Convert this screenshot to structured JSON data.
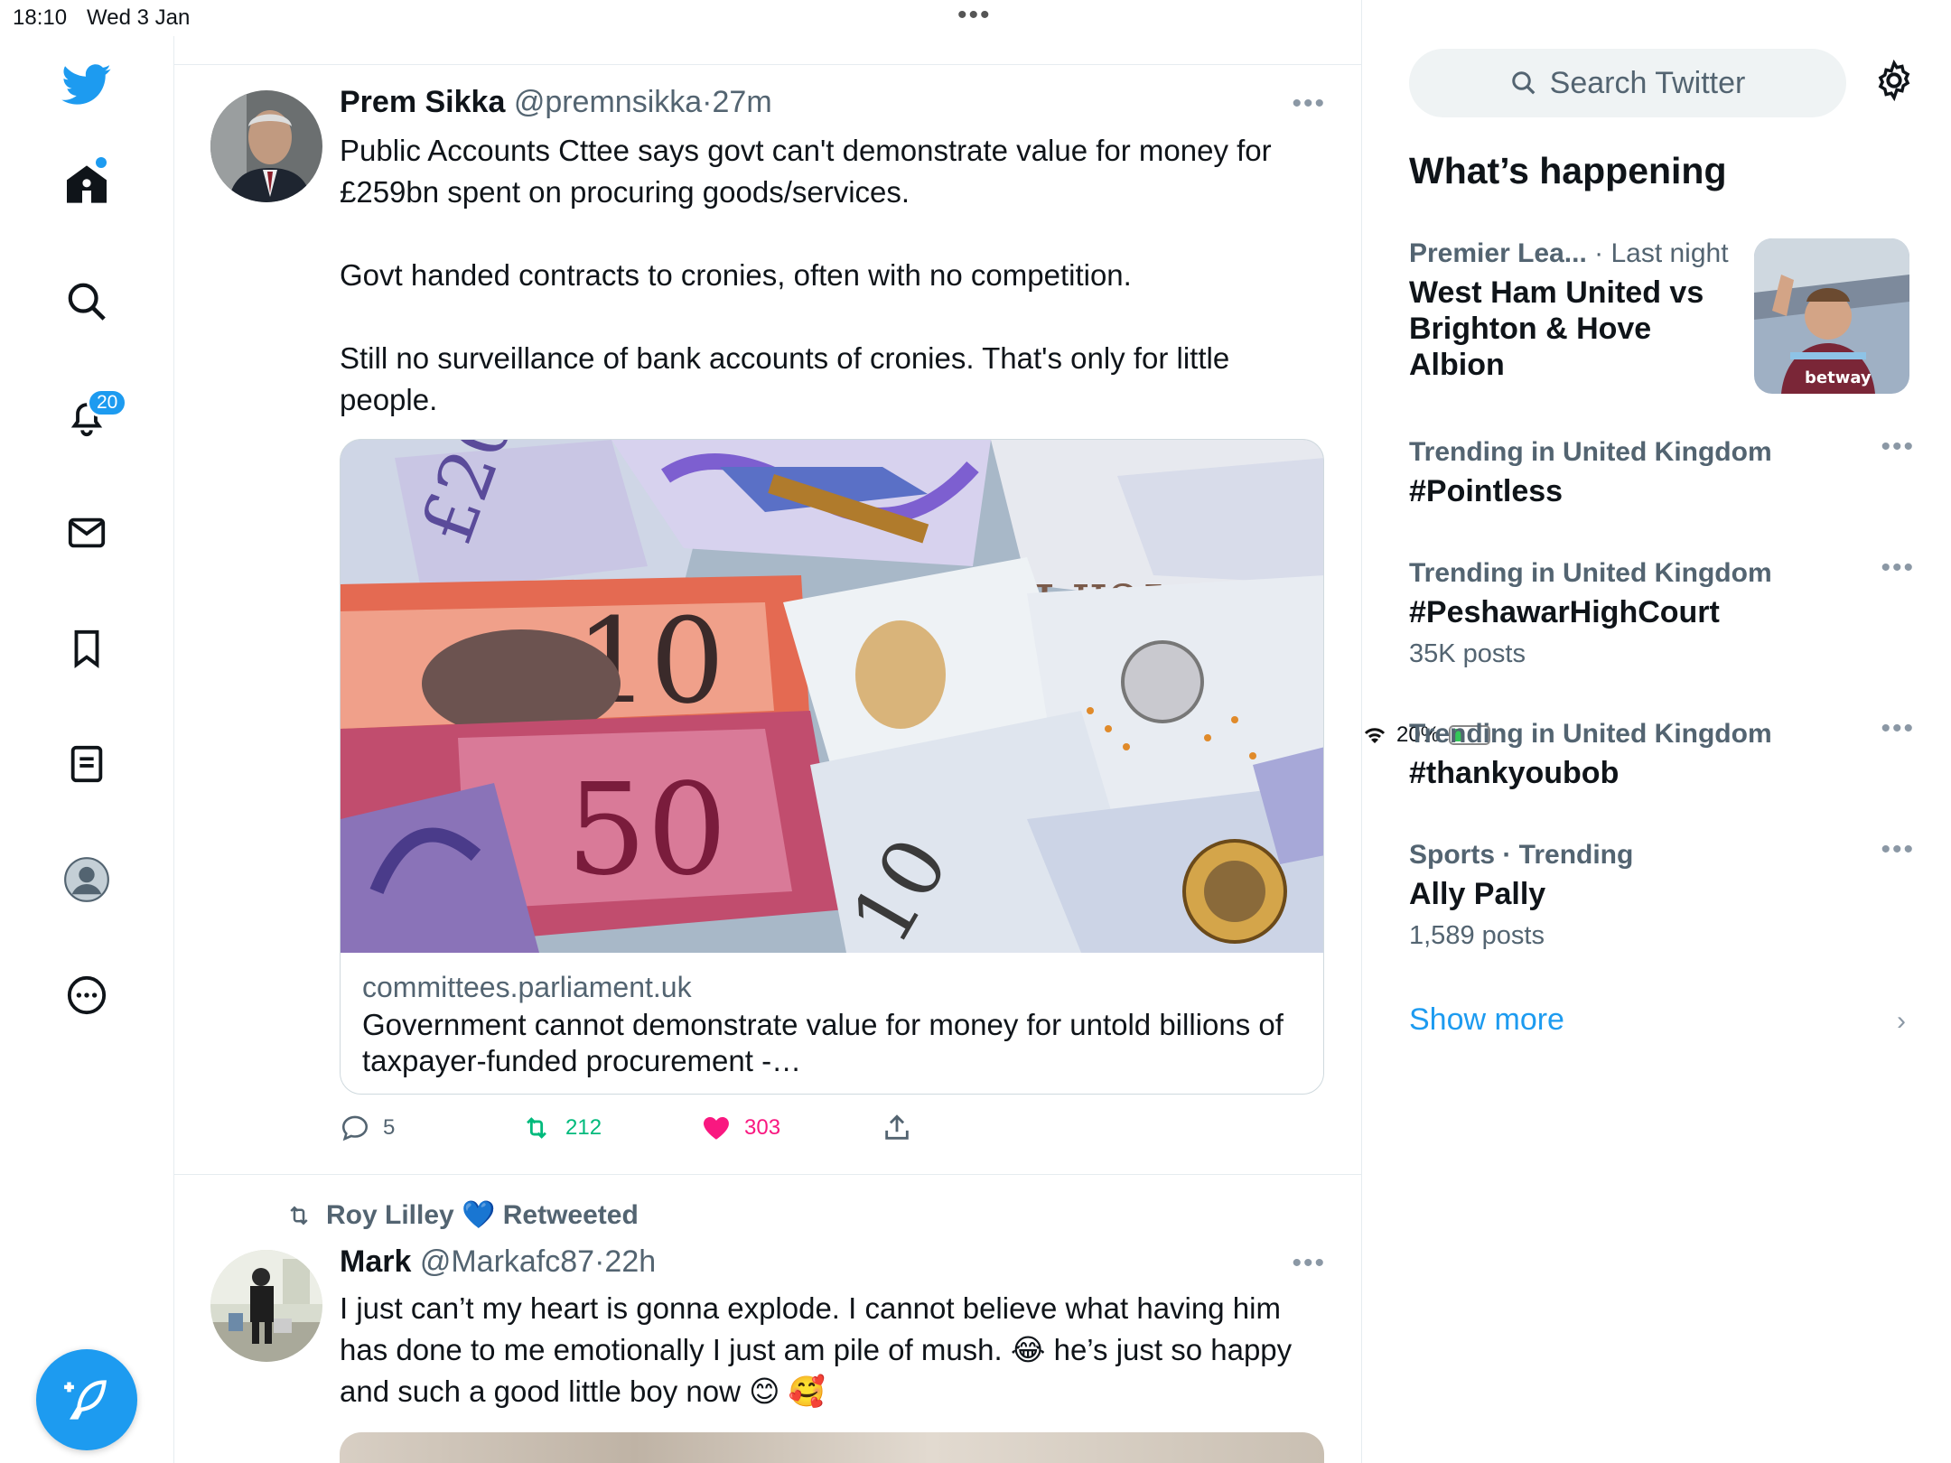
{
  "status": {
    "time": "18:10",
    "date": "Wed 3 Jan",
    "battery": "20%"
  },
  "nav": {
    "items": [
      "twitter-logo",
      "home",
      "explore",
      "notifications",
      "messages",
      "bookmarks",
      "lists",
      "profile",
      "more"
    ],
    "notifications_badge": "20"
  },
  "tweet1": {
    "name": "Prem Sikka",
    "handle": "@premnsikka",
    "time": "27m",
    "text_p1": "Public Accounts Cttee says govt can't demonstrate value for money for £259bn spent on procuring goods/services.",
    "text_p2": "Govt handed contracts to cronies, often with no competition.",
    "text_p3": "Still no surveillance of bank accounts of cronies. That's only for little people.",
    "card_domain": "committees.parliament.uk",
    "card_title": "Government cannot demonstrate value for money for untold billions of taxpayer-funded procurement -…",
    "replies": "5",
    "retweets": "212",
    "likes": "303"
  },
  "tweet2": {
    "retweeted_by": "Roy Lilley 💙 Retweeted",
    "name": "Mark",
    "handle": "@Markafc87",
    "time": "22h",
    "text": "I just can’t my heart is gonna explode. I cannot believe what having him has done to me emotionally I just am pile of mush. 😂 he’s just so happy and such a good little boy now 😊 🥰"
  },
  "sidebar": {
    "search_placeholder": "Search Twitter",
    "title": "What’s happening",
    "trends": [
      {
        "context": "Premier Lea...",
        "context_extra": "· Last night",
        "title": "West Ham United vs Brighton & Hove Albion",
        "count": ""
      },
      {
        "context": "Trending in United Kingdom",
        "title": "#Pointless",
        "count": ""
      },
      {
        "context": "Trending in United Kingdom",
        "title": "#PeshawarHighCourt",
        "count": "35K posts"
      },
      {
        "context": "Trending in United Kingdom",
        "title": "#thankyoubob",
        "count": ""
      },
      {
        "context": "Sports · Trending",
        "title": "Ally Pally",
        "count": "1,589 posts"
      }
    ],
    "show_more": "Show more"
  },
  "colors": {
    "accent": "#1d9bf0",
    "like": "#f91880",
    "retweet": "#00ba7c",
    "muted": "#536471"
  }
}
